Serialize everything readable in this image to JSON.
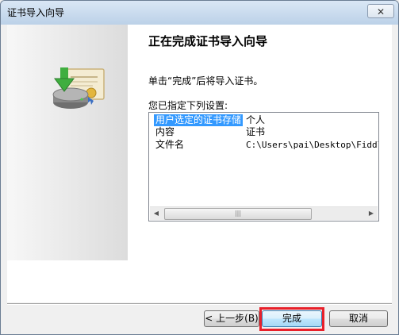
{
  "window": {
    "title": "证书导入向导",
    "close_symbol": "✕"
  },
  "page": {
    "heading": "正在完成证书导入向导",
    "description": "单击“完成”后将导入证书。",
    "list_label": "您已指定下列设置:"
  },
  "settings": [
    {
      "key": "用户选定的证书存储",
      "value": "个人",
      "selected": true
    },
    {
      "key": "内容",
      "value": "证书",
      "selected": false
    },
    {
      "key": "文件名",
      "value": "C:\\Users\\pai\\Desktop\\Fiddl",
      "selected": false
    }
  ],
  "buttons": {
    "back": "< 上一步(B)",
    "finish": "完成",
    "cancel": "取消"
  },
  "icons": {
    "wizard": "certificate-import-icon",
    "scroll_left": "◀",
    "scroll_right": "▶",
    "scroll_grip": "|||"
  },
  "colors": {
    "highlight": "#e8202a",
    "selection": "#3399ff"
  }
}
